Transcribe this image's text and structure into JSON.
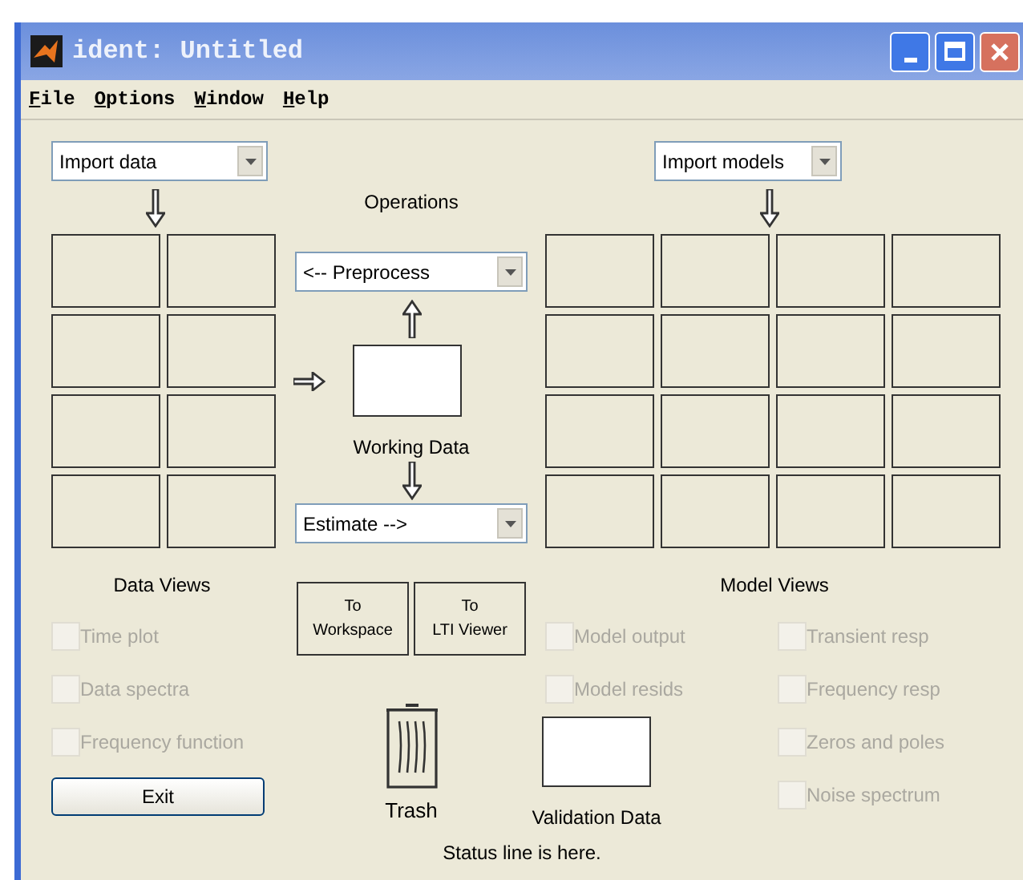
{
  "window": {
    "title": "ident: Untitled"
  },
  "menu": [
    {
      "label": "File"
    },
    {
      "label": "Options"
    },
    {
      "label": "Window"
    },
    {
      "label": "Help"
    }
  ],
  "data_panel": {
    "dropdown": "Import data",
    "title": "Data Views",
    "checkboxes": [
      {
        "label": "Time plot",
        "checked": false,
        "disabled": true
      },
      {
        "label": "Data spectra",
        "checked": false,
        "disabled": true
      },
      {
        "label": "Frequency function",
        "checked": false,
        "disabled": true
      }
    ],
    "exit_button": "Exit"
  },
  "operations": {
    "title": "Operations",
    "preprocess": "<-- Preprocess",
    "working_data": "Working Data",
    "estimate": "Estimate -->",
    "buttons": [
      {
        "lines": [
          "To",
          "Workspace"
        ]
      },
      {
        "lines": [
          "To",
          "LTI Viewer"
        ]
      }
    ],
    "trash": "Trash",
    "validation_data": "Validation Data"
  },
  "model_panel": {
    "dropdown": "Import models",
    "title": "Model Views",
    "column_1": [
      {
        "label": "Model output",
        "checked": false,
        "disabled": true
      },
      {
        "label": "Model resids",
        "checked": false,
        "disabled": true
      }
    ],
    "column_2": [
      {
        "label": "Transient resp",
        "checked": false,
        "disabled": true
      },
      {
        "label": "Frequency resp",
        "checked": false,
        "disabled": true
      },
      {
        "label": "Zeros and poles",
        "checked": false,
        "disabled": true
      },
      {
        "label": "Noise spectrum",
        "checked": false,
        "disabled": true
      }
    ]
  },
  "status_line": "Status line is here."
}
